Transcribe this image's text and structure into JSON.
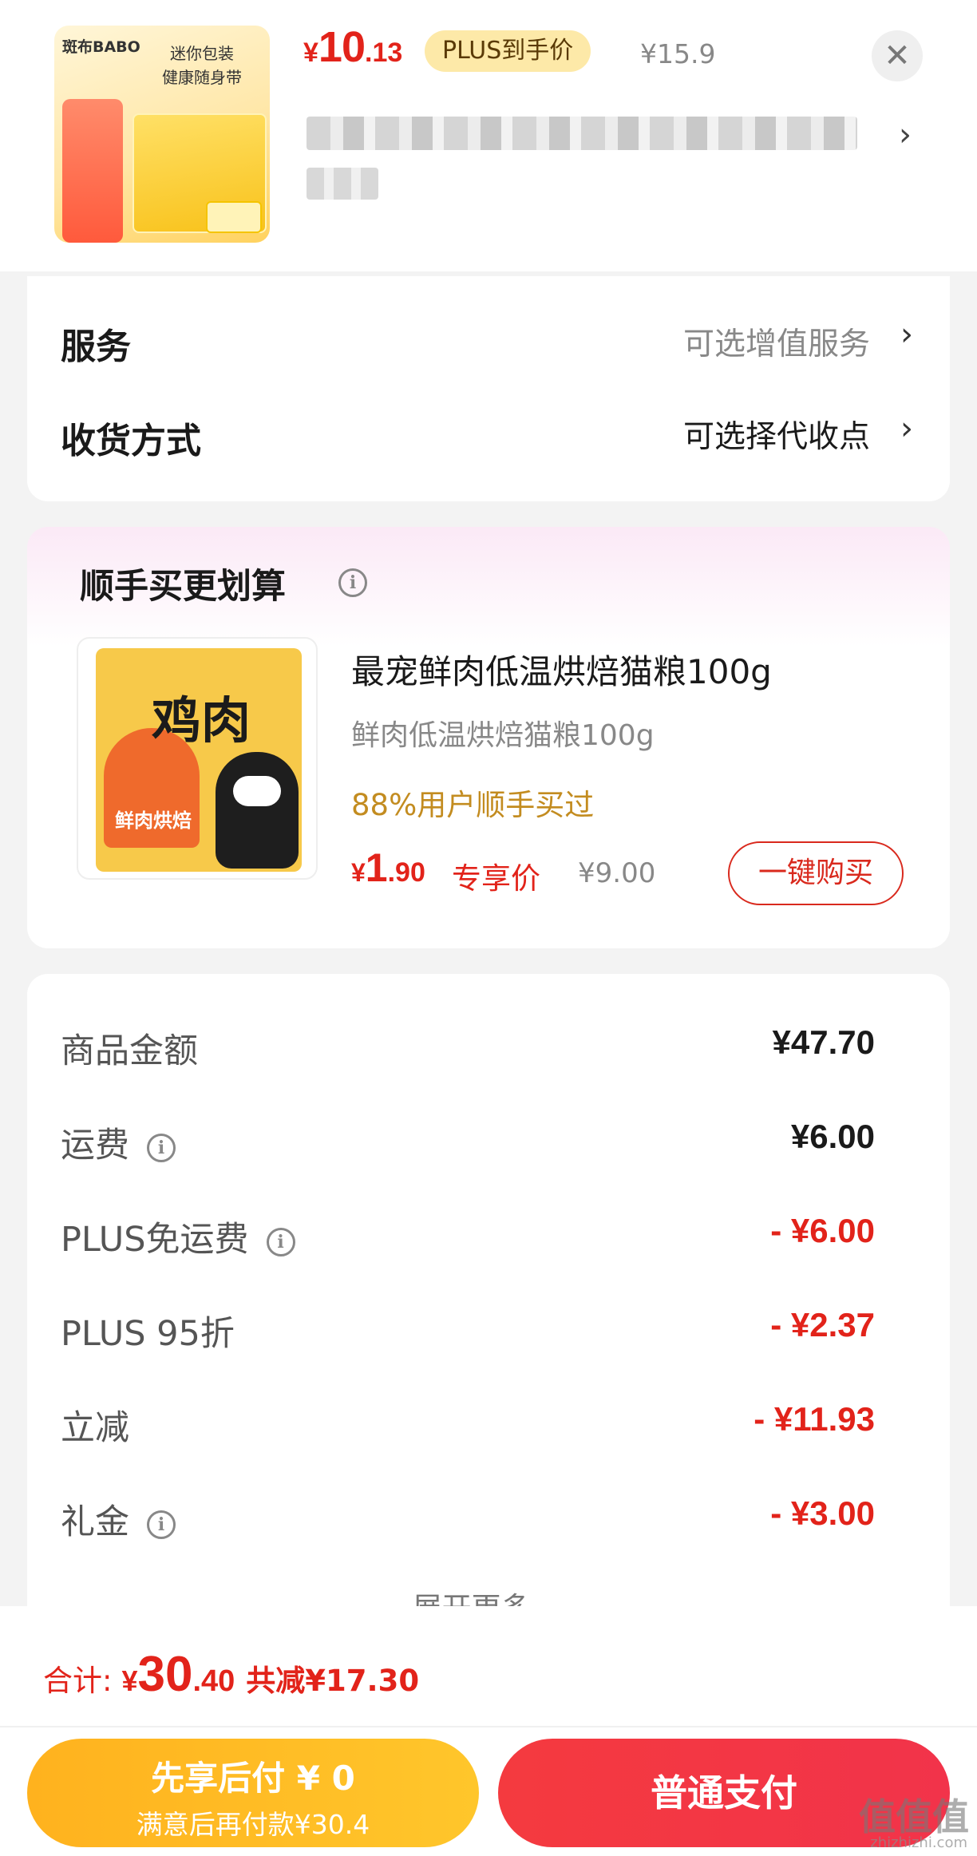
{
  "product": {
    "thumb_brand": "斑布BABO",
    "thumb_tag_line1": "迷你包装",
    "thumb_tag_line2": "健康随身带",
    "price_yen": "¥",
    "price_int": "10",
    "price_dec": ".13",
    "plus_badge": "PLUS到手价",
    "original_price": "¥15.9",
    "close_icon": "close-icon",
    "title_chevron": "›"
  },
  "service": {
    "service_label": "服务",
    "service_value": "可选增值服务",
    "delivery_label": "收货方式",
    "delivery_value": "可选择代收点",
    "chevron": "›",
    "service_value_color": "#888888",
    "delivery_value_color": "#1a1a1a"
  },
  "upsell": {
    "title": "顺手买更划算",
    "info_icon": "i",
    "image_text": "鸡肉",
    "image_label": "鲜肉烘焙",
    "name": "最宠鲜肉低温烘焙猫粮100g",
    "subtitle": "鲜肉低温烘焙猫粮100g",
    "popularity": "88%用户顺手买过",
    "price_yen": "¥",
    "price_int": "1",
    "price_dec": ".90",
    "price_label": "专享价",
    "original_price": "¥9.00",
    "buy_button": "一键购买"
  },
  "summary": {
    "rows": [
      {
        "label": "商品金额",
        "value": "¥47.70"
      },
      {
        "label": "运费",
        "value": "¥6.00"
      },
      {
        "label": "PLUS免运费",
        "value": "- ¥6.00"
      },
      {
        "label": "PLUS 95折",
        "value": "- ¥2.37"
      },
      {
        "label": "立减",
        "value": "- ¥11.93"
      },
      {
        "label": "礼金",
        "value": "- ¥3.00"
      }
    ],
    "info_icon": "i",
    "expand_more": "展开更多 ⌄"
  },
  "bottom": {
    "total_label": "合计:",
    "total_yen": "¥",
    "total_int": "30",
    "total_dec": ".40",
    "total_saved": "共减¥17.30",
    "pay_later_title": "先享后付 ¥ 0",
    "pay_later_sub": "满意后再付款¥30.4",
    "normal_pay": "普通支付",
    "watermark": "值值值",
    "watermark_sub": "zhizhizhi.com"
  },
  "colors": {
    "accent_red": "#e2231a",
    "plus_gold": "#fde9a8",
    "popularity_gold": "#c38c20",
    "pay_later_yellow": "#ffb21e",
    "pay_red": "#f43a3f"
  }
}
